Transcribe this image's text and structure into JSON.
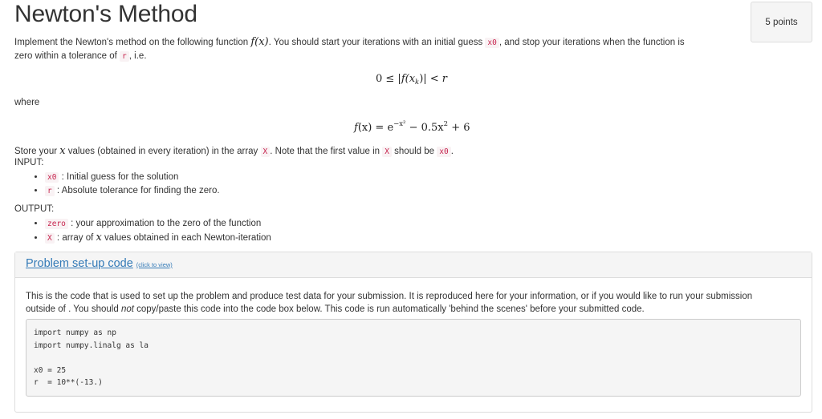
{
  "page": {
    "title": "Newton's Method",
    "points_label": "5 points"
  },
  "intro": {
    "text1": "Implement the Newton's method on the following function ",
    "func_sym": "f(x)",
    "text2": ". You should start your iterations with an initial guess ",
    "var_x0": "x0",
    "text3": ", and stop your iterations when the function is",
    "text4": "zero within a tolerance of ",
    "var_r": "r",
    "text5": ", i.e."
  },
  "equations": {
    "tolerance": {
      "lhs": "0 ≤ |",
      "f": "f",
      "arg": "(x",
      "sub": "k",
      "close": ")| < ",
      "r": "r"
    },
    "where_label": "where",
    "function": {
      "f": "f",
      "arg": "(x) = e",
      "exp": "−x²",
      "rest": " − 0.5x",
      "pow": "2",
      "tail": " + 6"
    }
  },
  "store": {
    "text1": "Store your ",
    "var": "x",
    "text2": " values (obtained in every iteration) in the array ",
    "arr": "X",
    "text3": ". Note that the first value in ",
    "arr2": "X",
    "text4": " should be ",
    "x0": "x0",
    "text5": "."
  },
  "input": {
    "label": "INPUT:",
    "items": [
      {
        "code": "x0",
        "desc": " : Initial guess for the solution"
      },
      {
        "code": "r",
        "desc": " : Absolute tolerance for finding the zero."
      }
    ]
  },
  "output": {
    "label": "OUTPUT:",
    "items": [
      {
        "code": "zero",
        "desc": " : your approximation to the zero of the function"
      },
      {
        "code": "X",
        "desc_pre": " : array of ",
        "desc_var": "x",
        "desc_post": " values obtained in each Newton-iteration"
      }
    ]
  },
  "setup_panel": {
    "title": "Problem set-up code",
    "hint": "(click to view)",
    "description_1": "This is the code that is used to set up the problem and produce test data for your submission. It is reproduced here for your information, or if you would like to run your submission",
    "description_2a": "outside of . You should ",
    "description_not": "not",
    "description_2b": " copy/paste this code into the code box below. This code is run automatically 'behind the scenes' before your submitted code.",
    "code_lines": [
      "import numpy as np",
      "import numpy.linalg as la",
      "",
      "x0 = 25",
      "r  = 10**(-13.)"
    ]
  }
}
